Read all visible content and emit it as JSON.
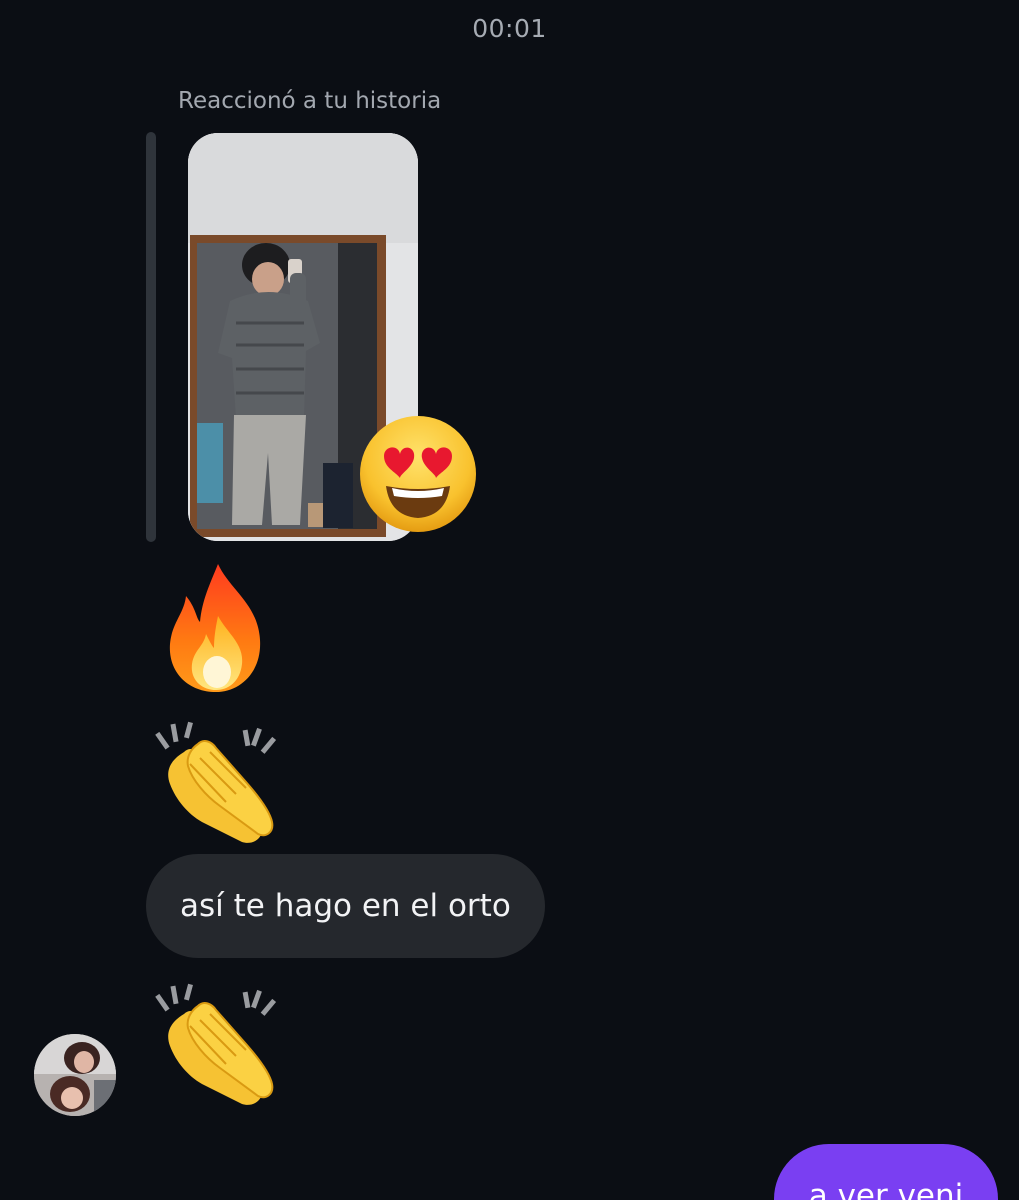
{
  "thread": {
    "timestamp": "00:01"
  },
  "story_reply": {
    "label": "Reaccionó a tu historia",
    "reaction_icon": "heart-eyes-emoji",
    "thumbnail_icon": "story-mirror-selfie-image"
  },
  "messages": [
    {
      "type": "emoji",
      "icon": "fire-emoji"
    },
    {
      "type": "emoji",
      "icon": "clapping-hands-emoji"
    },
    {
      "type": "text",
      "text": "así te hago en el orto"
    },
    {
      "type": "emoji",
      "icon": "clapping-hands-emoji"
    }
  ],
  "sent": {
    "text": "a ver veni"
  },
  "colors": {
    "background": "#0b0e14",
    "received_bubble": "#25282d",
    "sent_bubble": "#7a3ff2",
    "secondary_text": "#a3a8b0"
  }
}
